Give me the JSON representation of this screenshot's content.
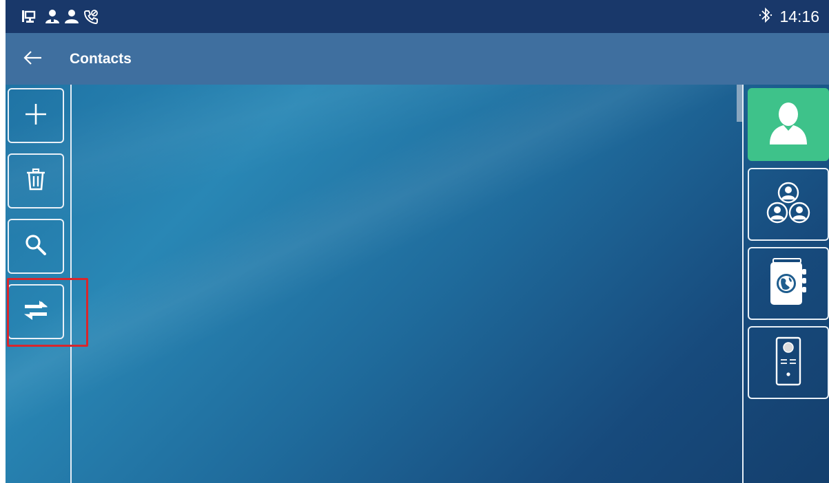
{
  "status_bar": {
    "left_icons": [
      "network-icon",
      "contact-icon",
      "user-icon",
      "call-forward-icon"
    ],
    "bluetooth_icon": "bluetooth-icon",
    "time": "14:16"
  },
  "title_bar": {
    "back_icon": "back-arrow-icon",
    "title": "Contacts"
  },
  "left_toolbar": {
    "buttons": [
      {
        "name": "add-contact-button",
        "icon": "plus-icon"
      },
      {
        "name": "delete-contact-button",
        "icon": "trash-icon"
      },
      {
        "name": "search-contact-button",
        "icon": "search-icon"
      },
      {
        "name": "import-export-button",
        "icon": "swap-arrows-icon",
        "highlighted": true
      }
    ]
  },
  "right_sidebar": {
    "tabs": [
      {
        "name": "local-contacts-tab",
        "icon": "person-icon",
        "active": true
      },
      {
        "name": "groups-tab",
        "icon": "group-icon",
        "active": false
      },
      {
        "name": "ldap-phonebook-tab",
        "icon": "phonebook-globe-icon",
        "active": false
      },
      {
        "name": "door-phone-tab",
        "icon": "intercom-icon",
        "active": false
      }
    ]
  },
  "colors": {
    "status_bar": "#19386a",
    "title_bar": "#3f6f9f",
    "active_tab": "#3ec28a",
    "highlight": "#d8262c"
  }
}
